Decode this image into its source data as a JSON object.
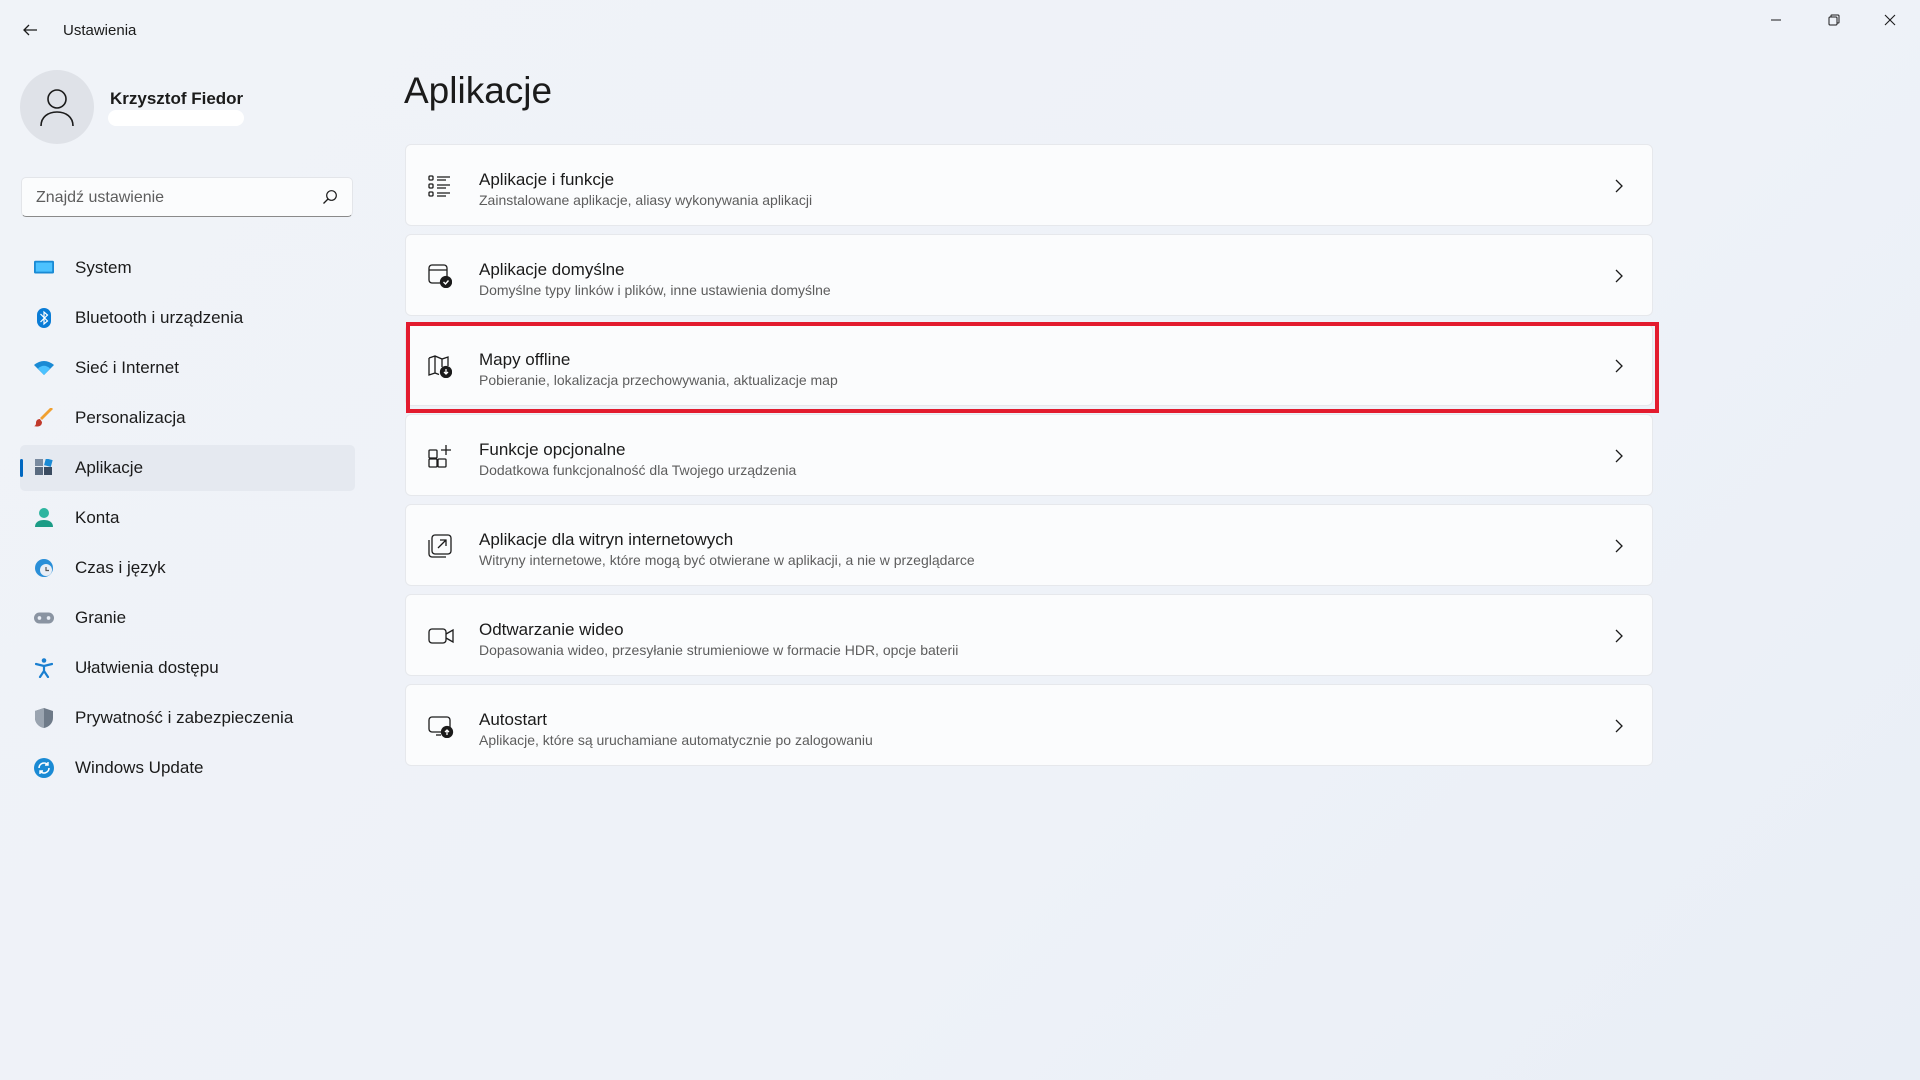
{
  "window": {
    "title": "Ustawienia",
    "controls": [
      "minimize",
      "restore",
      "close"
    ]
  },
  "profile": {
    "name": "Krzysztof Fiedor"
  },
  "search": {
    "placeholder": "Znajdź ustawienie"
  },
  "sidebar": {
    "items": [
      {
        "label": "System",
        "icon": "monitor-icon"
      },
      {
        "label": "Bluetooth i urządzenia",
        "icon": "bluetooth-icon"
      },
      {
        "label": "Sieć i Internet",
        "icon": "wifi-icon"
      },
      {
        "label": "Personalizacja",
        "icon": "brush-icon"
      },
      {
        "label": "Aplikacje",
        "icon": "apps-icon",
        "selected": true
      },
      {
        "label": "Konta",
        "icon": "person-icon"
      },
      {
        "label": "Czas i język",
        "icon": "globe-clock-icon"
      },
      {
        "label": "Granie",
        "icon": "gamepad-icon"
      },
      {
        "label": "Ułatwienia dostępu",
        "icon": "accessibility-icon"
      },
      {
        "label": "Prywatność i zabezpieczenia",
        "icon": "shield-icon"
      },
      {
        "label": "Windows Update",
        "icon": "update-icon"
      }
    ]
  },
  "main": {
    "title": "Aplikacje",
    "cards": [
      {
        "title": "Aplikacje i funkcje",
        "subtitle": "Zainstalowane aplikacje, aliasy wykonywania aplikacji",
        "icon": "list-icon"
      },
      {
        "title": "Aplikacje domyślne",
        "subtitle": "Domyślne typy linków i plików, inne ustawienia domyślne",
        "icon": "default-apps-icon"
      },
      {
        "title": "Mapy offline",
        "subtitle": "Pobieranie, lokalizacja przechowywania, aktualizacje map",
        "icon": "offline-map-icon",
        "highlighted": true
      },
      {
        "title": "Funkcje opcjonalne",
        "subtitle": "Dodatkowa funkcjonalność dla Twojego urządzenia",
        "icon": "optional-features-icon"
      },
      {
        "title": "Aplikacje dla witryn internetowych",
        "subtitle": "Witryny internetowe, które mogą być otwierane w aplikacji, a nie w przeglądarce",
        "icon": "open-in-app-icon"
      },
      {
        "title": "Odtwarzanie wideo",
        "subtitle": "Dopasowania wideo, przesyłanie strumieniowe w formacie HDR, opcje baterii",
        "icon": "video-icon"
      },
      {
        "title": "Autostart",
        "subtitle": "Aplikacje, które są uruchamiane automatycznie po zalogowaniu",
        "icon": "startup-icon"
      }
    ]
  },
  "colors": {
    "accent": "#0067c0",
    "highlight_border": "#e31b2e"
  }
}
